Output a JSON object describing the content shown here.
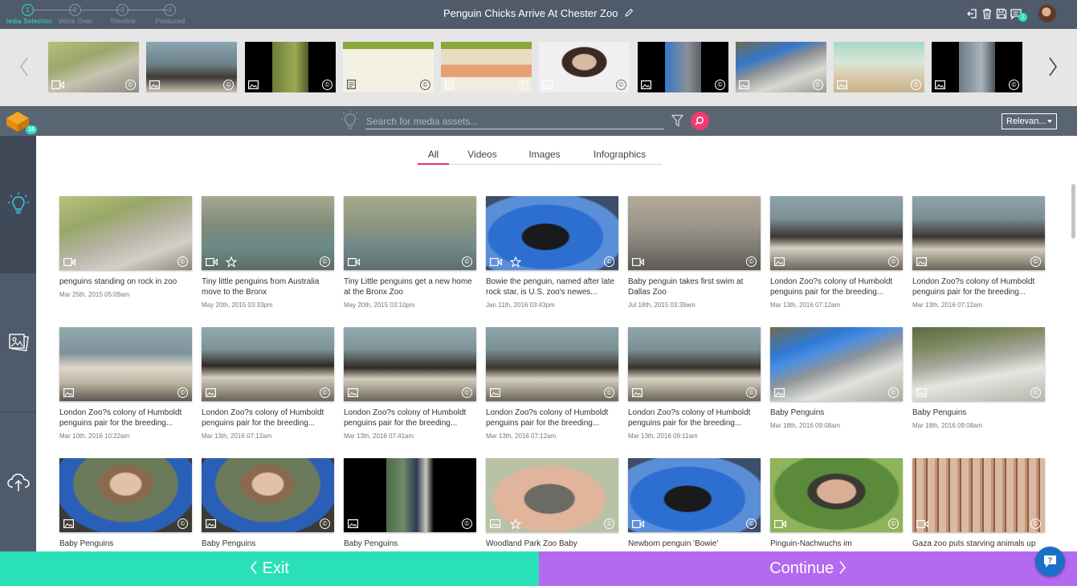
{
  "steps": [
    {
      "num": "1",
      "label": "Media Selection",
      "shown": "tedia Selection",
      "active": true
    },
    {
      "num": "2",
      "label": "Voice Over",
      "active": false
    },
    {
      "num": "3",
      "label": "Timeline",
      "active": false
    },
    {
      "num": "4",
      "label": "Produced",
      "active": false
    }
  ],
  "header": {
    "title": "Penguin Chicks Arrive At Chester Zoo",
    "notification_count": "1"
  },
  "strip": {
    "items": [
      {
        "kind": "video",
        "icon": "video-icon"
      },
      {
        "kind": "image",
        "icon": "image-icon"
      },
      {
        "kind": "image",
        "icon": "image-icon"
      },
      {
        "kind": "document",
        "icon": "document-icon"
      },
      {
        "kind": "document",
        "icon": "document-icon"
      },
      {
        "kind": "image",
        "icon": "image-icon"
      },
      {
        "kind": "image",
        "icon": "image-icon"
      },
      {
        "kind": "image",
        "icon": "image-icon"
      },
      {
        "kind": "image",
        "icon": "image-icon"
      },
      {
        "kind": "image",
        "icon": "image-icon"
      }
    ]
  },
  "logo_badge": "19",
  "search": {
    "placeholder": "Search for media assets...",
    "sort_label": "Relevan..."
  },
  "tabs": [
    {
      "label": "All",
      "active": true
    },
    {
      "label": "Videos",
      "active": false
    },
    {
      "label": "Images",
      "active": false
    },
    {
      "label": "Infographics",
      "active": false
    }
  ],
  "cards": [
    {
      "title": "penguins standing on rock in zoo",
      "date": "Mar 25th, 2015   05:09am",
      "kind": "video",
      "star": false
    },
    {
      "title": "Tiny little penguins from Australia move to the Bronx",
      "date": "May 20th, 2015   03:33pm",
      "kind": "video",
      "star": true
    },
    {
      "title": "Tiny Little penguins get a new home at the Bronx Zoo",
      "date": "May 20th, 2015   03:10pm",
      "kind": "video",
      "star": false
    },
    {
      "title": "Bowie the penguin, named after late rock star, is U.S. zoo's newes...",
      "date": "Jan 11th, 2016   03:43pm",
      "kind": "video",
      "star": true
    },
    {
      "title": "Baby penguin takes first swim at Dallas Zoo",
      "date": "Jul 18th, 2015   03:39am",
      "kind": "video",
      "star": false
    },
    {
      "title": "London Zoo?s colony of Humboldt penguins pair for the breeding...",
      "date": "Mar 13th, 2016   07:12am",
      "kind": "image",
      "star": false
    },
    {
      "title": "London Zoo?s colony of Humboldt penguins pair for the breeding...",
      "date": "Mar 13th, 2016   07:12am",
      "kind": "image",
      "star": false
    },
    {
      "title": "London Zoo?s colony of Humboldt penguins pair for the breeding...",
      "date": "Mar 10th, 2016   10:22am",
      "kind": "image",
      "star": false
    },
    {
      "title": "London Zoo?s colony of Humboldt penguins pair for the breeding...",
      "date": "Mar 13th, 2016   07:12am",
      "kind": "image",
      "star": false
    },
    {
      "title": "London Zoo?s colony of Humboldt penguins pair for the breeding...",
      "date": "Mar 13th, 2016   07:41am",
      "kind": "image",
      "star": false
    },
    {
      "title": "London Zoo?s colony of Humboldt penguins pair for the breeding...",
      "date": "Mar 13th, 2016   07:12am",
      "kind": "image",
      "star": false
    },
    {
      "title": "London Zoo?s colony of Humboldt penguins pair for the breeding...",
      "date": "Mar 13th, 2016   09:11am",
      "kind": "image",
      "star": false
    },
    {
      "title": "Baby Penguins",
      "date": "Mar 18th, 2016   09:08am",
      "kind": "image",
      "star": false
    },
    {
      "title": "Baby Penguins",
      "date": "Mar 18th, 2016   09:08am",
      "kind": "image",
      "star": false
    },
    {
      "title": "Baby Penguins",
      "date": "",
      "kind": "image",
      "star": false
    },
    {
      "title": "Baby Penguins",
      "date": "",
      "kind": "image",
      "star": false
    },
    {
      "title": "Baby Penguins",
      "date": "",
      "kind": "image",
      "star": false
    },
    {
      "title": "Woodland Park Zoo Baby",
      "date": "",
      "kind": "image",
      "star": true
    },
    {
      "title": "Newborn penguin 'Bowie'",
      "date": "",
      "kind": "video",
      "star": false
    },
    {
      "title": "Pinguin-Nachwuchs im",
      "date": "",
      "kind": "video",
      "star": false
    },
    {
      "title": "Gaza zoo puts starving animals up",
      "date": "",
      "kind": "video",
      "star": false
    }
  ],
  "footer": {
    "exit_label": "Exit",
    "continue_label": "Continue"
  },
  "colors": {
    "accent_teal": "#2ae0b7",
    "accent_purple": "#b469f0",
    "accent_pink": "#f03c6e",
    "topbar": "#4f5b6b"
  }
}
